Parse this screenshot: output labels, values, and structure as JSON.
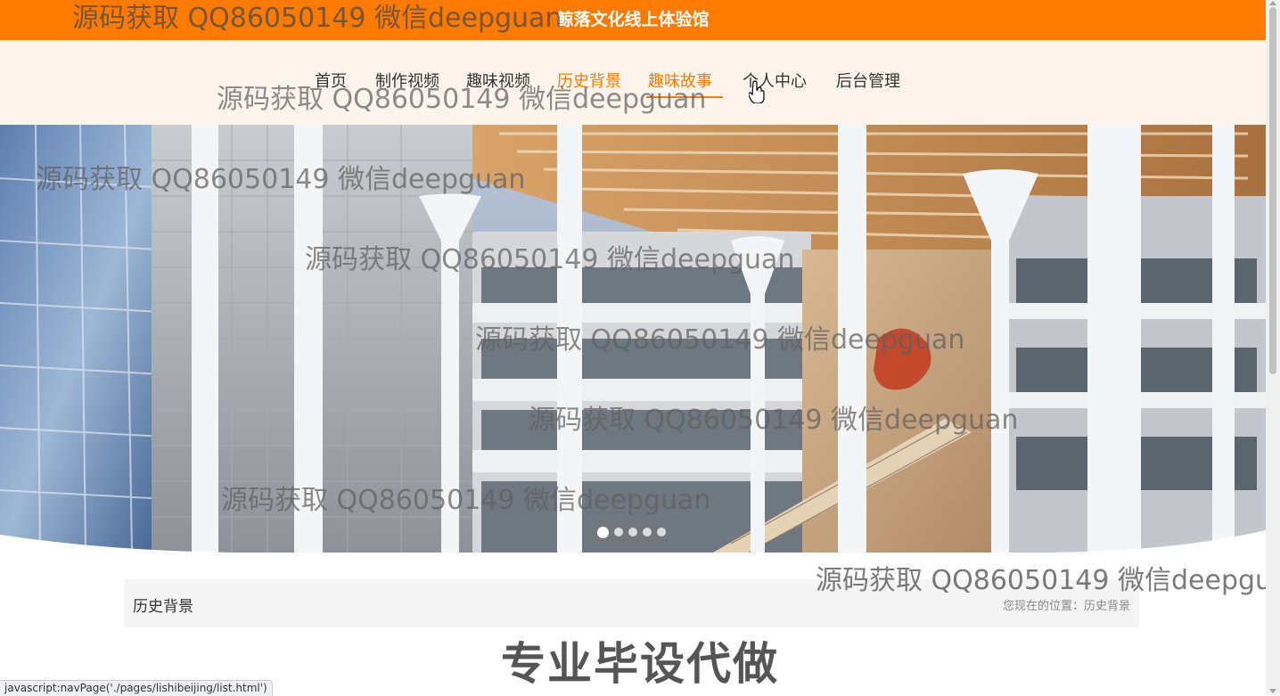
{
  "header": {
    "site_title": "鲸落文化线上体验馆"
  },
  "nav": {
    "items": [
      {
        "label": "首页"
      },
      {
        "label": "制作视频"
      },
      {
        "label": "趣味视频"
      },
      {
        "label": "历史背景"
      },
      {
        "label": "趣味故事"
      },
      {
        "label": "个人中心"
      },
      {
        "label": "后台管理"
      }
    ],
    "active_label": "历史背景",
    "hover_label": "趣味故事"
  },
  "banner": {
    "slide_count": 5,
    "active_slide": 1
  },
  "breadcrumb": {
    "title": "历史背景",
    "location": "您现在的位置：历史背景"
  },
  "promo": {
    "text": "专业毕设代做"
  },
  "status_bar": {
    "url": "javascript:navPage('./pages/lishibeijing/list.html')"
  },
  "watermark": {
    "text": "源码获取 QQ86050149 微信deepguan"
  },
  "colors": {
    "accent": "#ff7a00",
    "nav_bg": "#fdf5ec",
    "crumb_bg": "#f5f5f5"
  }
}
